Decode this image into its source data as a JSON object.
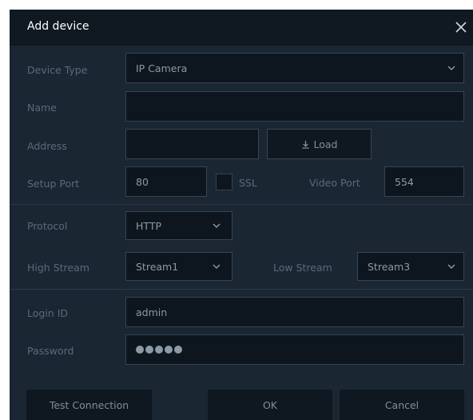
{
  "dialog": {
    "title": "Add device"
  },
  "form": {
    "device_type": {
      "label": "Device Type",
      "value": "IP Camera"
    },
    "name": {
      "label": "Name",
      "value": ""
    },
    "address": {
      "label": "Address",
      "value": "",
      "load_label": "Load"
    },
    "setup_port": {
      "label": "Setup Port",
      "value": "80"
    },
    "ssl": {
      "label": "SSL",
      "checked": false
    },
    "video_port": {
      "label": "Video Port",
      "value": "554"
    },
    "protocol": {
      "label": "Protocol",
      "value": "HTTP"
    },
    "high_stream": {
      "label": "High Stream",
      "value": "Stream1"
    },
    "low_stream": {
      "label": "Low Stream",
      "value": "Stream3"
    },
    "login_id": {
      "label": "Login ID",
      "value": "admin"
    },
    "password": {
      "label": "Password",
      "masked_length": 5
    }
  },
  "footer": {
    "test_connection": "Test Connection",
    "ok": "OK",
    "cancel": "Cancel"
  },
  "icons": {
    "close": "close-icon",
    "chevron": "chevron-down-icon",
    "download": "download-icon"
  },
  "colors": {
    "dialog_bg": "#1b2633",
    "titlebar_bg": "#101822",
    "field_bg": "#0d151e",
    "field_border": "#364454"
  }
}
